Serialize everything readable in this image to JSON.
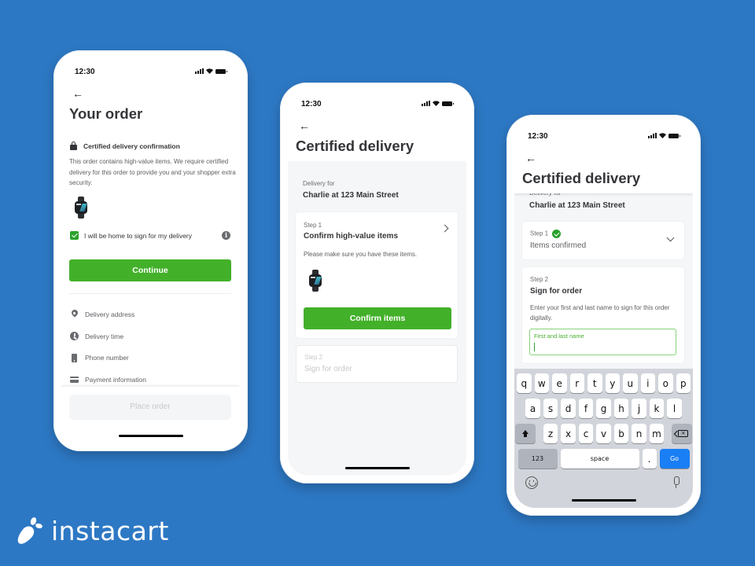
{
  "brand": {
    "name": "instacart",
    "background_color": "#2d78c4",
    "accent_green": "#43b02a",
    "keyboard_go_blue": "#1a7ef5"
  },
  "status_bar": {
    "time": "12:30",
    "icons": [
      "signal-icon",
      "wifi-icon",
      "battery-icon"
    ]
  },
  "screen1": {
    "back_icon": "arrow-left-icon",
    "title": "Your order",
    "certified_label": "Certified delivery confirmation",
    "certified_icon": "lock-icon",
    "description": "This order contains high-value items. We require certified delivery for this order to provide you and your shopper extra security.",
    "item_image": "smartwatch",
    "checkbox_label": "I will be home to sign for my delivery",
    "checkbox_checked": true,
    "info_icon": "info-icon",
    "continue_label": "Continue",
    "details": [
      {
        "icon": "pin-icon",
        "label": "Delivery address"
      },
      {
        "icon": "clock-icon",
        "label": "Delivery time"
      },
      {
        "icon": "phone-icon",
        "label": "Phone number"
      },
      {
        "icon": "card-icon",
        "label": "Payment information"
      }
    ],
    "place_order_label": "Place order",
    "place_order_disabled": true
  },
  "screen2": {
    "title": "Certified delivery",
    "delivery_for_label": "Delivery for",
    "delivery_for_value": "Charlie at 123 Main Street",
    "step1": {
      "label": "Step 1",
      "title": "Confirm high-value items",
      "description": "Please make sure you have these items.",
      "button_label": "Confirm items"
    },
    "step2": {
      "label": "Step 2",
      "title": "Sign for order",
      "disabled": true
    }
  },
  "screen3": {
    "title": "Certified delivery",
    "delivery_for_label": "Delivery for",
    "delivery_for_value": "Charlie at 123 Main Street",
    "step1": {
      "label": "Step 1",
      "status": "Items confirmed",
      "completed": true
    },
    "step2": {
      "label": "Step 2",
      "title": "Sign for order",
      "description": "Enter your first and last name to sign for this order digitally.",
      "input_placeholder": "First and last name",
      "input_value": ""
    },
    "keyboard": {
      "row1": [
        "q",
        "w",
        "e",
        "r",
        "t",
        "y",
        "u",
        "i",
        "o",
        "p"
      ],
      "row2": [
        "a",
        "s",
        "d",
        "f",
        "g",
        "h",
        "j",
        "k",
        "l"
      ],
      "row3": [
        "z",
        "x",
        "c",
        "v",
        "b",
        "n",
        "m"
      ],
      "numbers_label": "123",
      "space_label": "space",
      "period_label": ".",
      "go_label": "Go"
    }
  }
}
